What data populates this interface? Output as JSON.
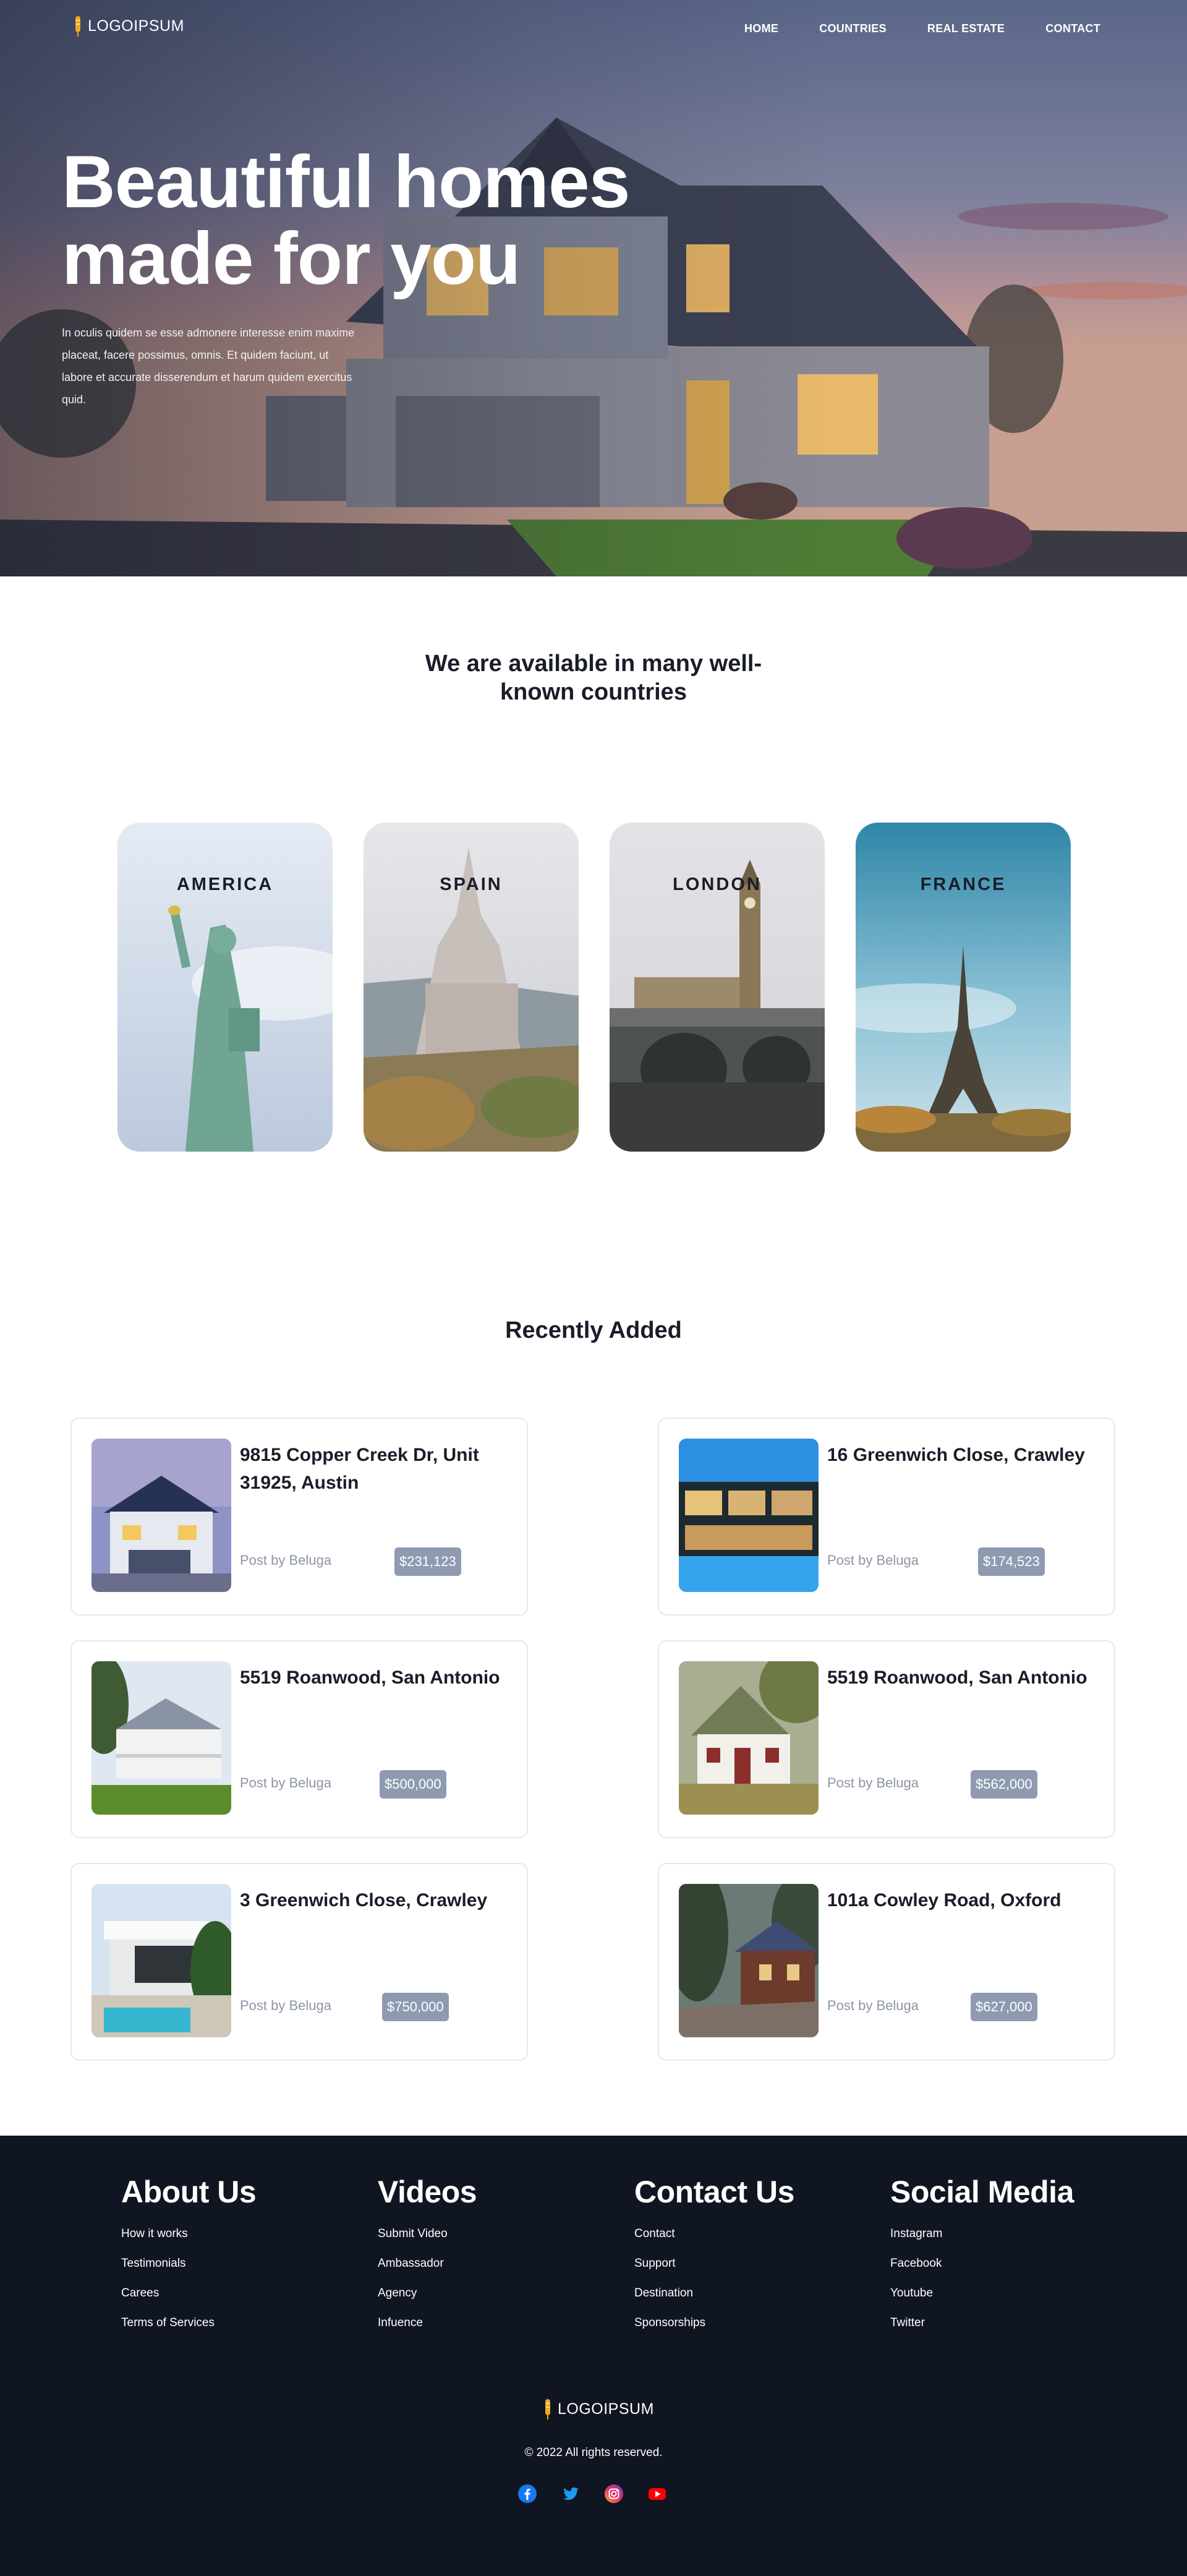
{
  "brand": {
    "logo_text": "LOGOIPSUM"
  },
  "nav": [
    {
      "label": "HOME"
    },
    {
      "label": "COUNTRIES"
    },
    {
      "label": "REAL ESTATE"
    },
    {
      "label": "CONTACT"
    }
  ],
  "hero": {
    "title_line1": "Beautiful homes",
    "title_line2": "made for you",
    "text": "In oculis quidem se esse admonere interesse enim maxime placeat, facere possimus, omnis. Et quidem faciunt, ut labore et accurate disserendum et harum quidem exercitus quid."
  },
  "countries": {
    "heading": "We are available in many well-known countries",
    "items": [
      {
        "label": "AMERICA"
      },
      {
        "label": "SPAIN"
      },
      {
        "label": "LONDON"
      },
      {
        "label": "FRANCE"
      }
    ]
  },
  "recent": {
    "heading": "Recently Added",
    "listings": [
      {
        "address": "9815 Copper Creek Dr, Unit 31925, Austin",
        "posted_by": "Post by Beluga",
        "price": "$231,123"
      },
      {
        "address": "16 Greenwich Close, Crawley",
        "posted_by": "Post by Beluga",
        "price": "$174,523"
      },
      {
        "address": "5519 Roanwood, San Antonio",
        "posted_by": "Post by Beluga",
        "price": "$500,000"
      },
      {
        "address": "5519 Roanwood, San Antonio",
        "posted_by": "Post by Beluga",
        "price": "$562,000"
      },
      {
        "address": "3 Greenwich Close, Crawley",
        "posted_by": "Post by Beluga",
        "price": "$750,000"
      },
      {
        "address": "101a Cowley Road, Oxford",
        "posted_by": "Post by Beluga",
        "price": "$627,000"
      }
    ]
  },
  "footer": {
    "columns": [
      {
        "title": "About Us",
        "links": [
          "How it works",
          "Testimonials",
          "Carees",
          "Terms of Services"
        ]
      },
      {
        "title": "Videos",
        "links": [
          "Submit Video",
          "Ambassador",
          "Agency",
          "Infuence"
        ]
      },
      {
        "title": "Contact Us",
        "links": [
          "Contact",
          "Support",
          "Destination",
          "Sponsorships"
        ]
      },
      {
        "title": "Social Media",
        "links": [
          "Instagram",
          "Facebook",
          "Youtube",
          "Twitter"
        ]
      }
    ],
    "logo_text": "LOGOIPSUM",
    "copyright": "© 2022 All rights reserved.",
    "social_icons": [
      "facebook-icon",
      "twitter-icon",
      "instagram-icon",
      "youtube-icon"
    ]
  },
  "colors": {
    "footer_bg": "#101522",
    "price_badge": "#8e9ab0",
    "logo_accent": "#f0a81c",
    "muted_text": "#8d95a6"
  }
}
